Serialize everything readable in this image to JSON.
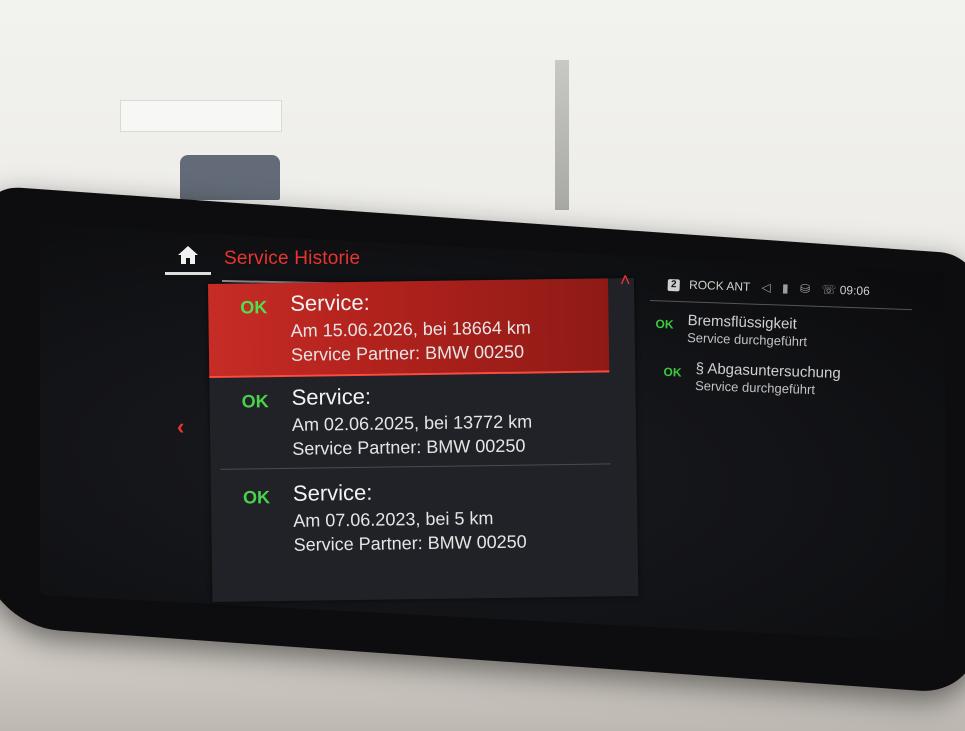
{
  "header": {
    "title": "Service Historie"
  },
  "status_bar": {
    "source_badge": "2",
    "source_label": "ROCK ANT",
    "time": "09:06",
    "icons": [
      "speaker-icon",
      "microphone-icon",
      "network-icon",
      "phone-icon"
    ]
  },
  "entries": [
    {
      "status": "OK",
      "title": "Service:",
      "date_line": "Am 15.06.2026, bei 18664 km",
      "partner_line": "Service Partner: BMW 00250",
      "selected": true
    },
    {
      "status": "OK",
      "title": "Service:",
      "date_line": "Am 02.06.2025, bei 13772 km",
      "partner_line": "Service Partner: BMW 00250",
      "selected": false
    },
    {
      "status": "OK",
      "title": "Service:",
      "date_line": "Am 07.06.2023, bei 5 km",
      "partner_line": "Service Partner: BMW 00250",
      "selected": false
    }
  ],
  "details": [
    {
      "status": "OK",
      "title": "Bremsflüssigkeit",
      "sub": "Service durchgeführt"
    },
    {
      "status": "OK",
      "title": "§ Abgasuntersuchung",
      "sub": "Service durchgeführt"
    }
  ],
  "colors": {
    "accent": "#e8352f",
    "ok_green": "#49d24a",
    "panel_bg": "#212228",
    "selected_bg": "#c72c26"
  }
}
